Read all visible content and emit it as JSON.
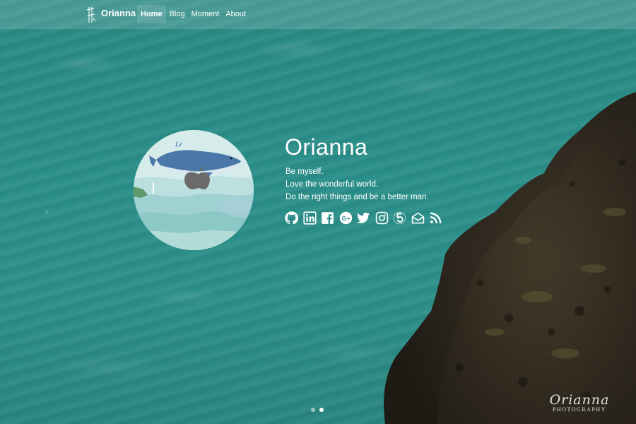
{
  "nav": {
    "brand": "Orianna",
    "links": [
      {
        "label": "Home",
        "active": true
      },
      {
        "label": "Blog",
        "active": false
      },
      {
        "label": "Moment",
        "active": false
      },
      {
        "label": "About",
        "active": false
      }
    ]
  },
  "profile": {
    "name": "Orianna",
    "bio": [
      "Be myself.",
      "Love the wonderful world.",
      "Do the right things and be a better man."
    ]
  },
  "social_icons": [
    "github-icon",
    "linkedin-icon",
    "facebook-icon",
    "google-plus-icon",
    "twitter-icon",
    "instagram-icon",
    "500px-icon",
    "email-icon",
    "rss-icon"
  ],
  "carousel": {
    "prev_glyph": "‹",
    "slide_count": 2,
    "active_slide": 2
  },
  "watermark": {
    "title": "Orianna",
    "subtitle": "PHOTOGRAPHY"
  },
  "colors": {
    "water": "#2b8f8a",
    "rock": "#3a3226",
    "text": "#ffffff"
  }
}
